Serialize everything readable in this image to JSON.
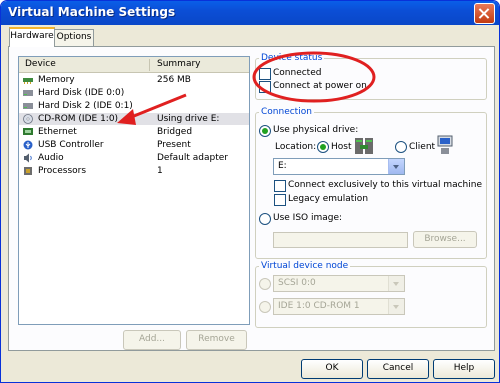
{
  "window": {
    "title": "Virtual Machine Settings"
  },
  "tabs": [
    {
      "label": "Hardware"
    },
    {
      "label": "Options"
    }
  ],
  "device_list": {
    "headers": {
      "device": "Device",
      "summary": "Summary"
    },
    "rows": [
      {
        "name": "Memory",
        "summary": "256 MB",
        "icon": "memory-icon"
      },
      {
        "name": "Hard Disk (IDE 0:0)",
        "summary": "",
        "icon": "hard-disk-icon"
      },
      {
        "name": "Hard Disk 2 (IDE 0:1)",
        "summary": "",
        "icon": "hard-disk-icon"
      },
      {
        "name": "CD-ROM (IDE 1:0)",
        "summary": "Using drive E:",
        "icon": "cdrom-icon",
        "selected": true
      },
      {
        "name": "Ethernet",
        "summary": "Bridged",
        "icon": "ethernet-icon"
      },
      {
        "name": "USB Controller",
        "summary": "Present",
        "icon": "usb-icon"
      },
      {
        "name": "Audio",
        "summary": "Default adapter",
        "icon": "audio-icon"
      },
      {
        "name": "Processors",
        "summary": "1",
        "icon": "processor-icon"
      }
    ],
    "add_label": "Add...",
    "remove_label": "Remove"
  },
  "device_status": {
    "label": "Device status",
    "connected_label": "Connected",
    "connected": false,
    "power_on_label": "Connect at power on",
    "power_on": false
  },
  "connection": {
    "label": "Connection",
    "physical_label": "Use physical drive:",
    "location_label": "Location:",
    "host_label": "Host",
    "client_label": "Client",
    "drive_value": "E:",
    "exclusive_label": "Connect exclusively to this virtual machine",
    "legacy_label": "Legacy emulation",
    "iso_label": "Use ISO image:",
    "iso_value": "",
    "browse_label": "Browse..."
  },
  "virtual_device_node": {
    "label": "Virtual device node",
    "scsi_value": "SCSI 0:0",
    "ide_value": "IDE 1:0  CD-ROM 1"
  },
  "footer": {
    "ok_label": "OK",
    "cancel_label": "Cancel",
    "help_label": "Help"
  },
  "annotation_color": "#e02020"
}
